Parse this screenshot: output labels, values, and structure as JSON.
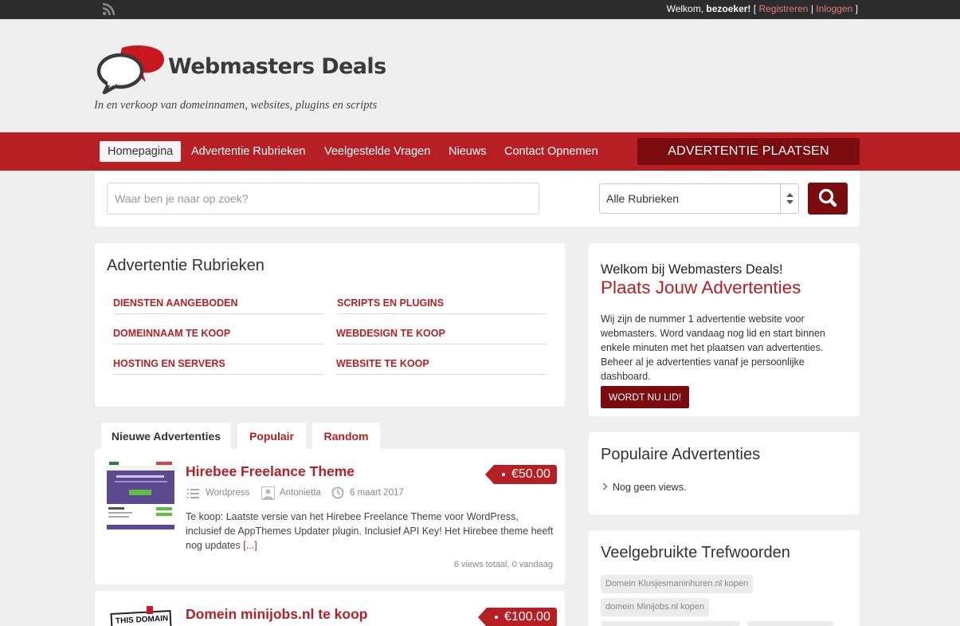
{
  "topbar": {
    "rss_icon": "rss-icon",
    "welcome_prefix": "Welkom, ",
    "welcome_user": "bezoeker!",
    "bracket_open": " [ ",
    "register": "Registreren",
    "separator": " | ",
    "login": "Inloggen",
    "bracket_close": " ]"
  },
  "header": {
    "brand": "Webmasters Deals",
    "tagline": "In en verkoop van domeinnamen, websites, plugins en scripts"
  },
  "nav": {
    "items": [
      "Homepagina",
      "Advertentie Rubrieken",
      "Veelgestelde Vragen",
      "Nieuws",
      "Contact Opnemen"
    ],
    "cta": "ADVERTENTIE PLAATSEN"
  },
  "search": {
    "placeholder": "Waar ben je naar op zoek?",
    "category": "Alle Rubrieken",
    "button_icon": "search-icon"
  },
  "categories": {
    "title": "Advertentie Rubrieken",
    "items": [
      "DIENSTEN AANGEBODEN",
      "SCRIPTS EN PLUGINS",
      "DOMEINNAAM TE KOOP",
      "WEBDESIGN TE KOOP",
      "HOSTING EN SERVERS",
      "WEBSITE TE KOOP"
    ]
  },
  "tabs": [
    "Nieuwe Advertenties",
    "Populair",
    "Random"
  ],
  "listings": [
    {
      "title": "Hirebee Freelance Theme",
      "price": "€50.00",
      "category": "Wordpress",
      "author": "Antonietta",
      "date": "6 maart 2017",
      "description": "Te koop: Laatste versie van het Hirebee Freelance Theme voor WordPress, inclusief de AppThemes Updater plugin. Inclusief API Key! Het Hirebee theme heeft nog updates",
      "more": "[...]",
      "views": "6 views totaal, 0 vandaag"
    },
    {
      "title": "Domein minijobs.nl te koop",
      "price": "€100.00",
      "thumb_text": "THIS DOMAIN"
    }
  ],
  "welcome_box": {
    "heading": "Welkom bij Webmasters Deals!",
    "subheading": "Plaats Jouw Advertenties",
    "text": "Wij zijn de nummer 1 advertentie website voor webmasters. Word vandaag nog lid en start binnen enkele minuten met het plaatsen van advertenties. Beheer al je advertenties vanaf je persoonlijke dashboard.",
    "button": "WORDT NU LID!"
  },
  "popular_box": {
    "title": "Populaire Advertenties",
    "empty": "Nog geen views."
  },
  "tags_box": {
    "title": "Veelgebruikte Trefwoorden",
    "tags": [
      "Domein Klusjesmaninhuren.nl kopen",
      "domein Minijobs.nl kopen"
    ]
  },
  "colors": {
    "brand_red": "#b61f24",
    "dark_red": "#7a0c0f"
  }
}
